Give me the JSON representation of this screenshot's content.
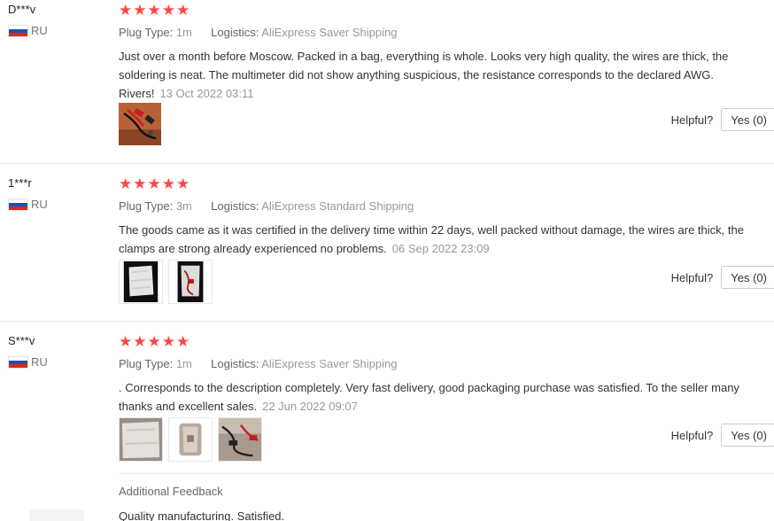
{
  "reviews": [
    {
      "reviewer": "D***v",
      "country": "RU",
      "rating": "★★★★★",
      "plug_type_label": "Plug Type:",
      "plug_type": "1m",
      "logistics_label": "Logistics:",
      "logistics": "AliExpress Saver Shipping",
      "text": "Just over a month before Moscow. Packed in a bag, everything is whole. Looks very high quality, the wires are thick, the soldering is neat. The multimeter did not show anything suspicious, the resistance corresponds to the declared AWG. Rivers!",
      "date": "13 Oct 2022 03:11",
      "photos": [
        "clamp-cable-photo"
      ],
      "helpful_label": "Helpful?",
      "yes_label": "Yes (0)"
    },
    {
      "reviewer": "1***r",
      "country": "RU",
      "rating": "★★★★★",
      "plug_type_label": "Plug Type:",
      "plug_type": "3m",
      "logistics_label": "Logistics:",
      "logistics": "AliExpress Standard Shipping",
      "text": "The goods came as it was certified in the delivery time within 22 days, well packed without damage, the wires are thick, the clamps are strong already experienced no problems.",
      "date": "06 Sep 2022 23:09",
      "photos": [
        "package-photo",
        "package-open-photo"
      ],
      "helpful_label": "Helpful?",
      "yes_label": "Yes (0)"
    },
    {
      "reviewer": "S***v",
      "country": "RU",
      "rating": "★★★★★",
      "plug_type_label": "Plug Type:",
      "plug_type": "1m",
      "logistics_label": "Logistics:",
      "logistics": "AliExpress Saver Shipping",
      "text": ". Corresponds to the description completely. Very fast delivery, good packaging purchase was satisfied. To the seller many thanks and excellent sales.",
      "date": "22 Jun 2022 09:07",
      "photos": [
        "bag-photo",
        "wrapped-photo",
        "cable-photo"
      ],
      "helpful_label": "Helpful?",
      "yes_label": "Yes (0)",
      "additional_feedback_label": "Additional Feedback",
      "additional_feedback": "Quality manufacturing. Satisfied."
    }
  ],
  "colors": {
    "star": "#ff4747",
    "divider": "#ececec",
    "muted": "#999999"
  }
}
